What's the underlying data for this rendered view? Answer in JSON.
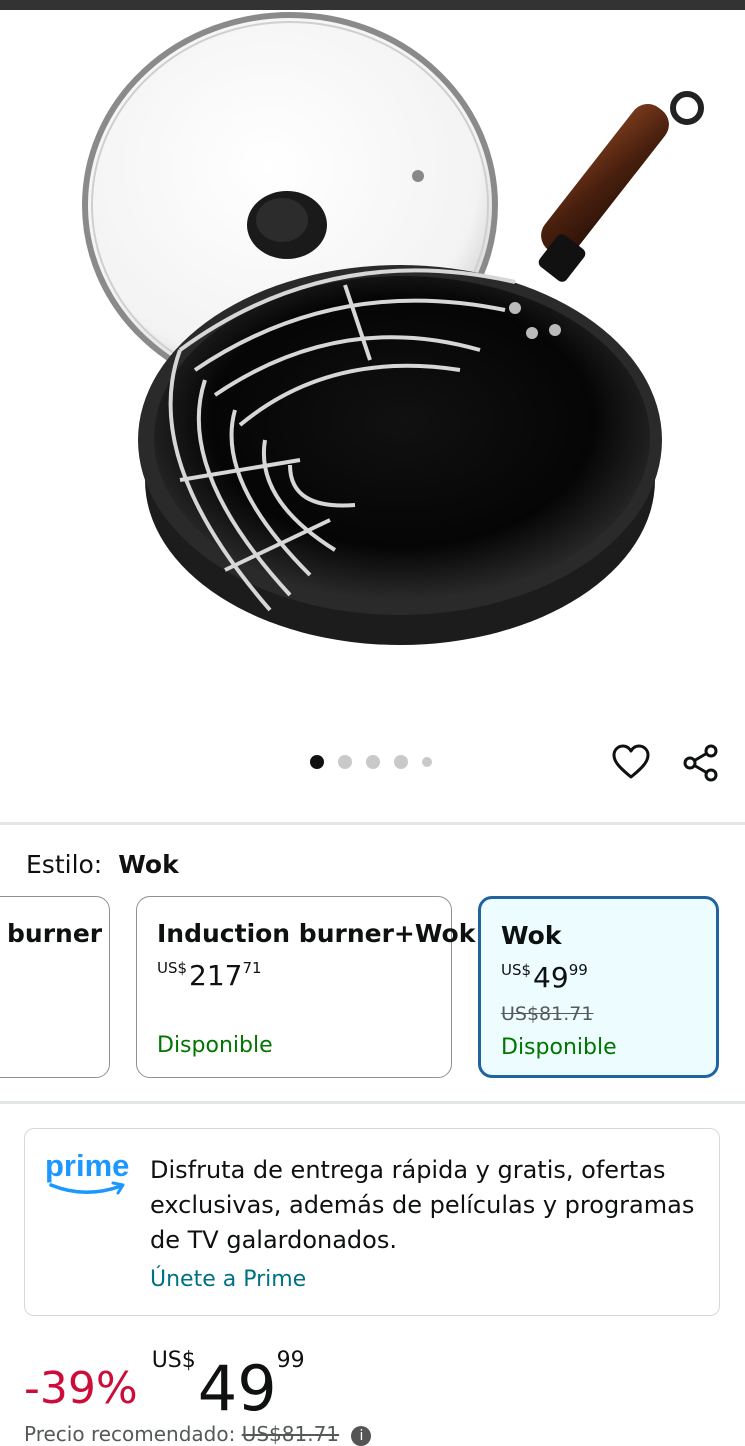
{
  "gallery": {
    "image_alt": "Wok with lid and rack",
    "image_count": 5,
    "active_index": 0
  },
  "style_selector": {
    "label": "Estilo:",
    "selected": "Wok",
    "options": [
      {
        "name": "burner",
        "price_currency": "",
        "price_whole": "",
        "price_cents": "",
        "strike_price": "",
        "availability": "",
        "selected": false
      },
      {
        "name": "Induction burner+Wok",
        "price_currency": "US$",
        "price_whole": "217",
        "price_cents": "71",
        "strike_price": "",
        "availability": "Disponible",
        "selected": false
      },
      {
        "name": "Wok",
        "price_currency": "US$",
        "price_whole": "49",
        "price_cents": "99",
        "strike_price": "US$81.71",
        "availability": "Disponible",
        "selected": true
      }
    ]
  },
  "prime": {
    "logo": "prime",
    "text": "Disfruta de entrega rápida y gratis, ofertas exclusivas, además de películas y programas de TV galardonados.",
    "link": "Únete a Prime"
  },
  "price": {
    "discount": "-39%",
    "currency": "US$",
    "whole": "49",
    "cents": "99",
    "recommended_label": "Precio recomendado:",
    "recommended_value": "US$81.71"
  },
  "colors": {
    "accent": "#2162a1",
    "discount": "#cc0c39",
    "available": "#007600",
    "link": "#007185"
  }
}
